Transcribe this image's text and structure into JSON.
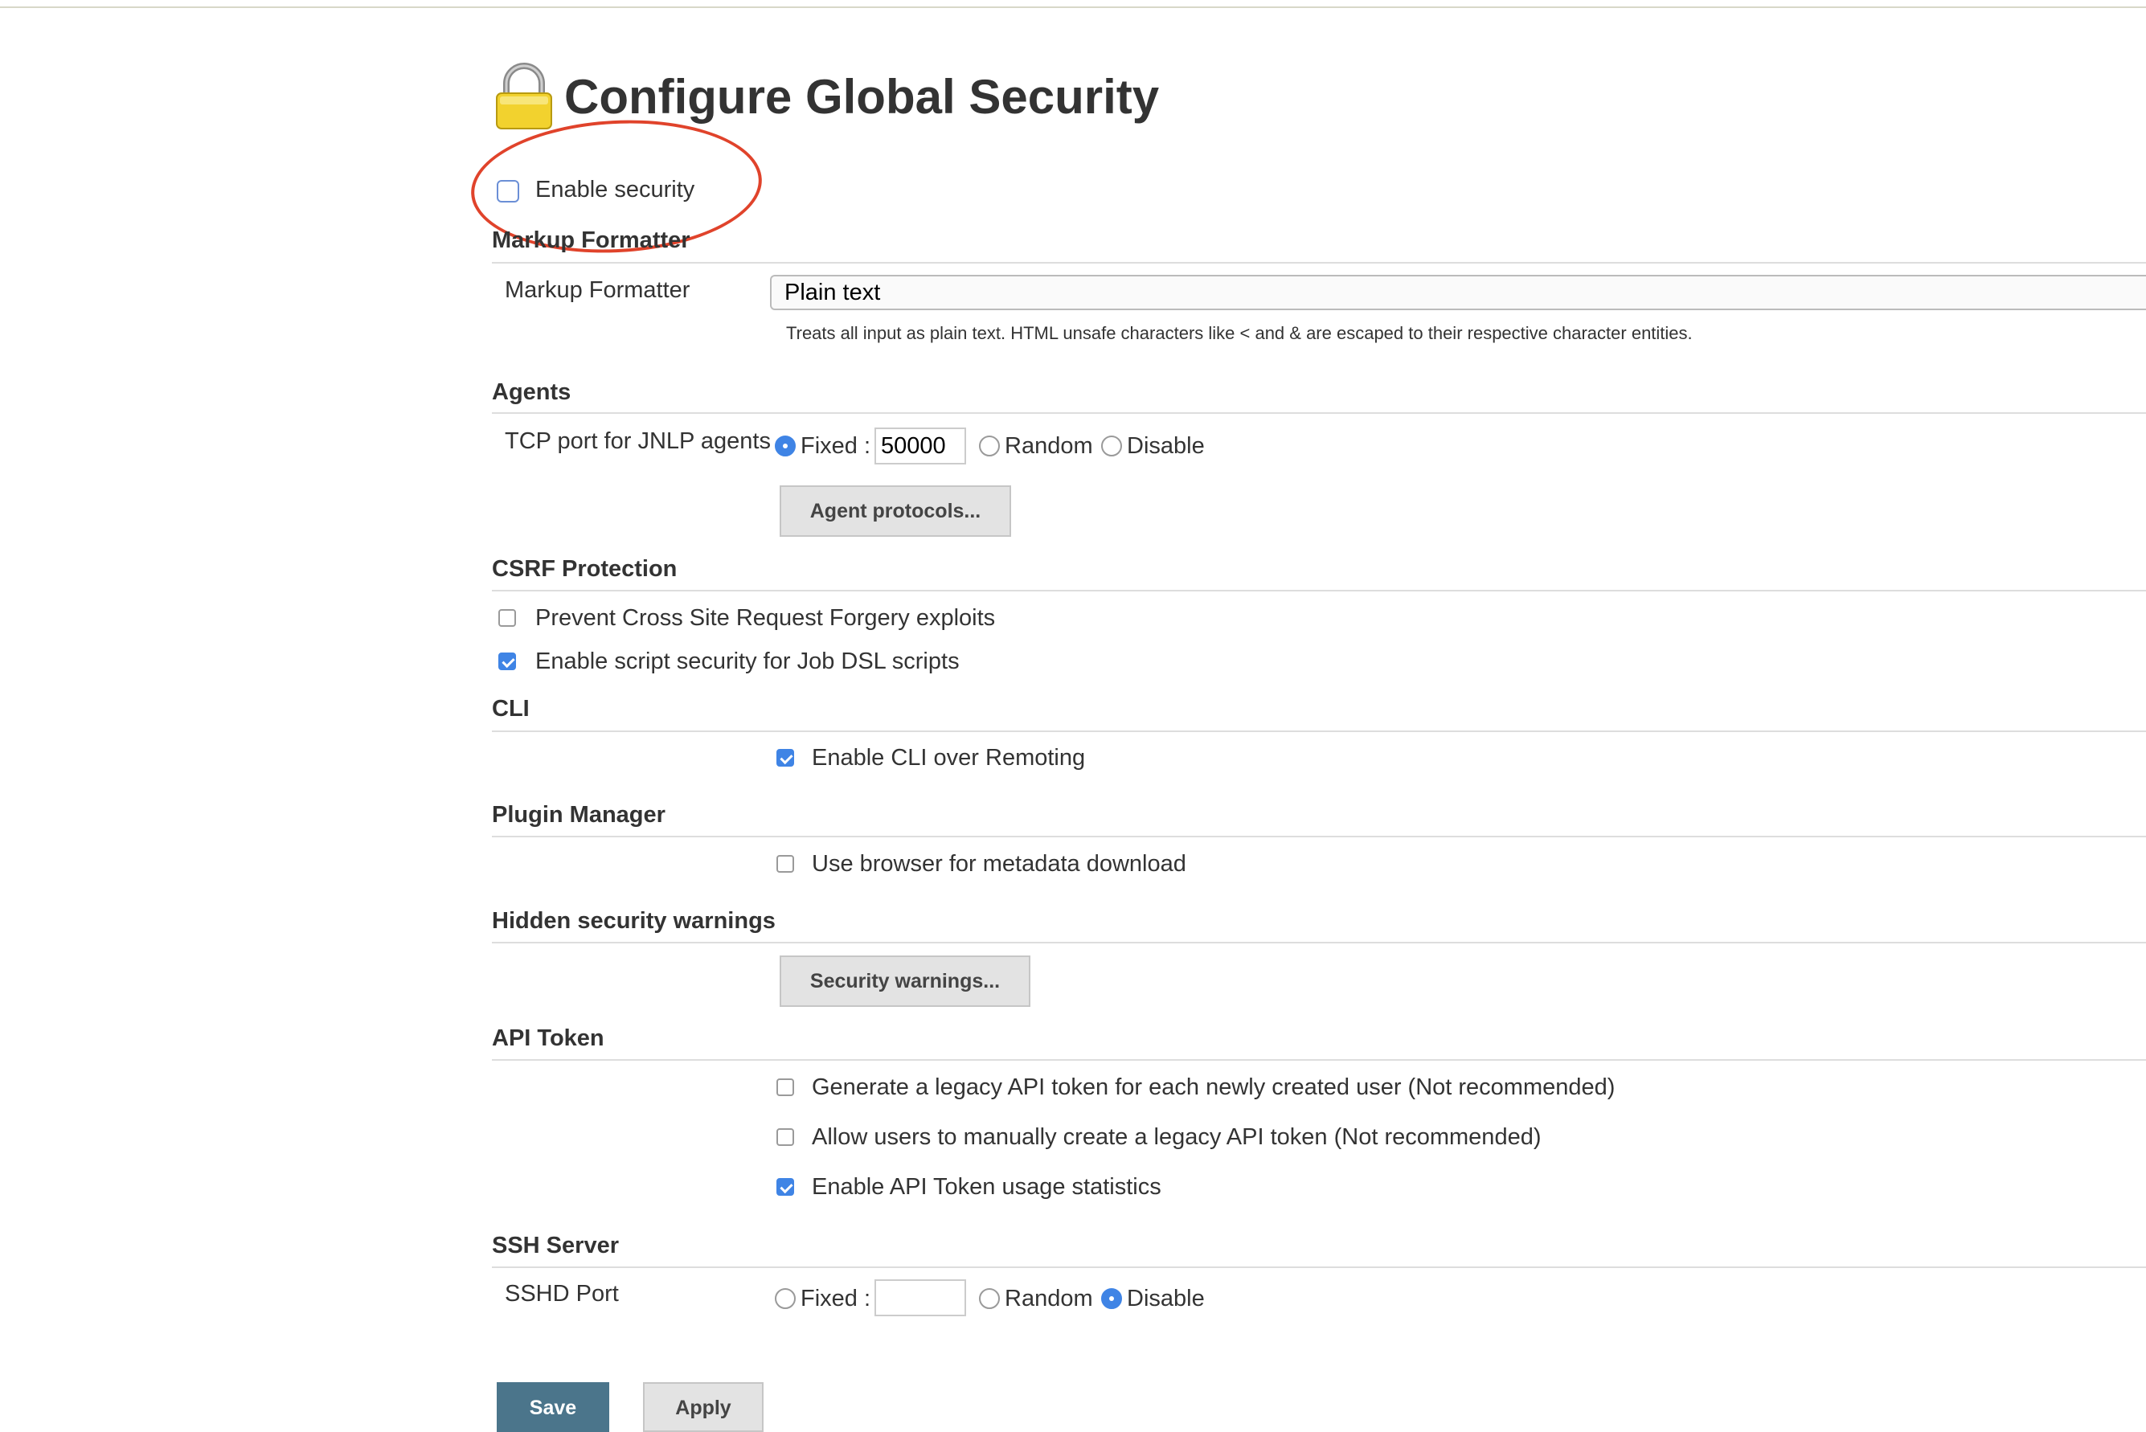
{
  "page": {
    "title": "Configure Global Security"
  },
  "enable_security": {
    "label": "Enable security",
    "checked": false
  },
  "markup_formatter": {
    "section_title": "Markup Formatter",
    "field_label": "Markup Formatter",
    "selected": "Plain text",
    "help": "Treats all input as plain text. HTML unsafe characters like < and & are escaped to their respective character entities."
  },
  "agents": {
    "section_title": "Agents",
    "field_label": "TCP port for JNLP agents",
    "options": [
      "Fixed :",
      "Random",
      "Disable"
    ],
    "selected": "Fixed :",
    "port": "50000",
    "protocols_button": "Agent protocols..."
  },
  "csrf": {
    "section_title": "CSRF Protection",
    "items": [
      {
        "label": "Prevent Cross Site Request Forgery exploits",
        "checked": false
      },
      {
        "label": "Enable script security for Job DSL scripts",
        "checked": true
      }
    ]
  },
  "cli": {
    "section_title": "CLI",
    "item": {
      "label": "Enable CLI over Remoting",
      "checked": true
    }
  },
  "plugin_manager": {
    "section_title": "Plugin Manager",
    "item": {
      "label": "Use browser for metadata download",
      "checked": false
    }
  },
  "hidden_warnings": {
    "section_title": "Hidden security warnings",
    "button": "Security warnings..."
  },
  "api_token": {
    "section_title": "API Token",
    "items": [
      {
        "label": "Generate a legacy API token for each newly created user (Not recommended)",
        "checked": false
      },
      {
        "label": "Allow users to manually create a legacy API token (Not recommended)",
        "checked": false
      },
      {
        "label": "Enable API Token usage statistics",
        "checked": true
      }
    ]
  },
  "ssh_server": {
    "section_title": "SSH Server",
    "field_label": "SSHD Port",
    "options": [
      "Fixed :",
      "Random",
      "Disable"
    ],
    "selected": "Disable",
    "port": ""
  },
  "actions": {
    "save": "Save",
    "apply": "Apply"
  },
  "colors": {
    "accent": "#3f84e5",
    "save_button": "#4b758b",
    "annotation": "#e0432b"
  }
}
